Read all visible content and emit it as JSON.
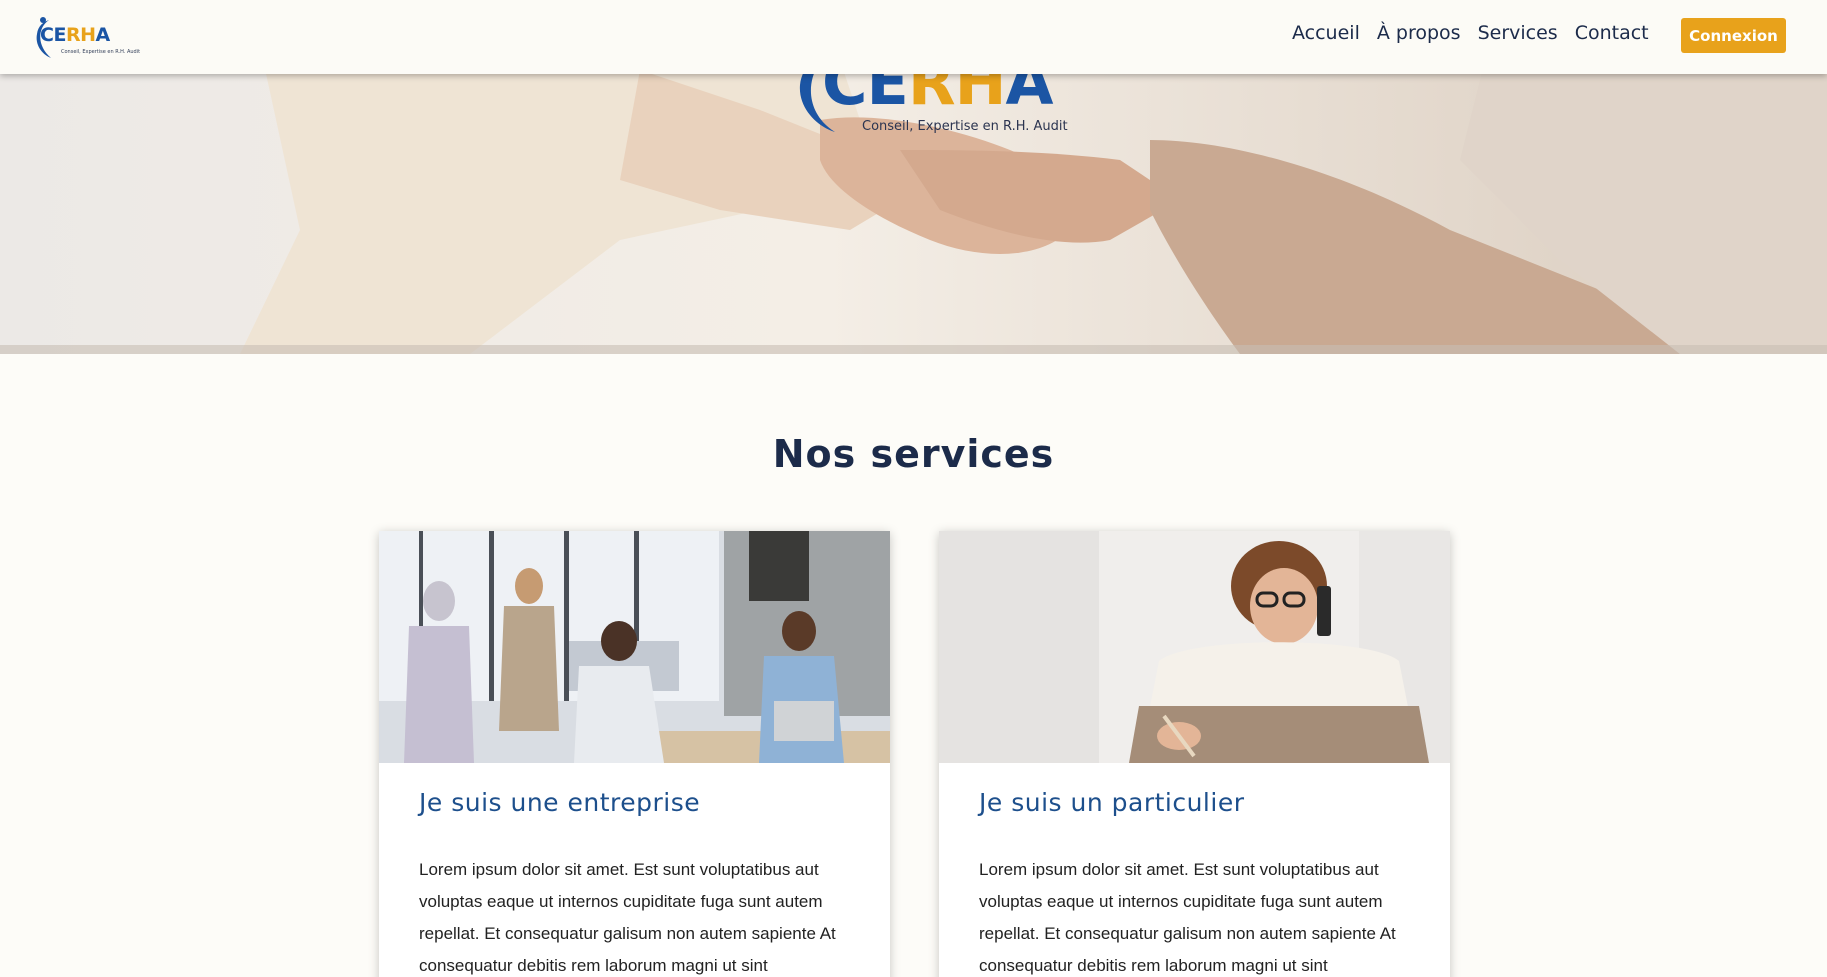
{
  "header": {
    "logo_text": "CERHA",
    "logo_tagline": "Conseil, Expertise en R.H. Audit",
    "nav": [
      "Accueil",
      "À propos",
      "Services",
      "Contact"
    ],
    "login_label": "Connexion"
  },
  "hero": {
    "logo_text": "CERHA",
    "logo_tagline": "Conseil, Expertise en R.H. Audit"
  },
  "services": {
    "title": "Nos services",
    "cards": [
      {
        "title": "Je suis une entreprise",
        "text": "Lorem ipsum dolor sit amet. Est sunt voluptatibus aut voluptas eaque ut internos cupiditate fuga sunt autem repellat. Et consequatur galisum non autem sapiente At consequatur debitis rem laborum magni ut sint"
      },
      {
        "title": "Je suis un particulier",
        "text": "Lorem ipsum dolor sit amet. Est sunt voluptatibus aut voluptas eaque ut internos cupiditate fuga sunt autem repellat. Et consequatur galisum non autem sapiente At consequatur debitis rem laborum magni ut sint"
      }
    ]
  },
  "colors": {
    "navy": "#1c2b4a",
    "blue": "#1d4f8c",
    "orange": "#e8a21b",
    "background": "#fdfcf8"
  }
}
